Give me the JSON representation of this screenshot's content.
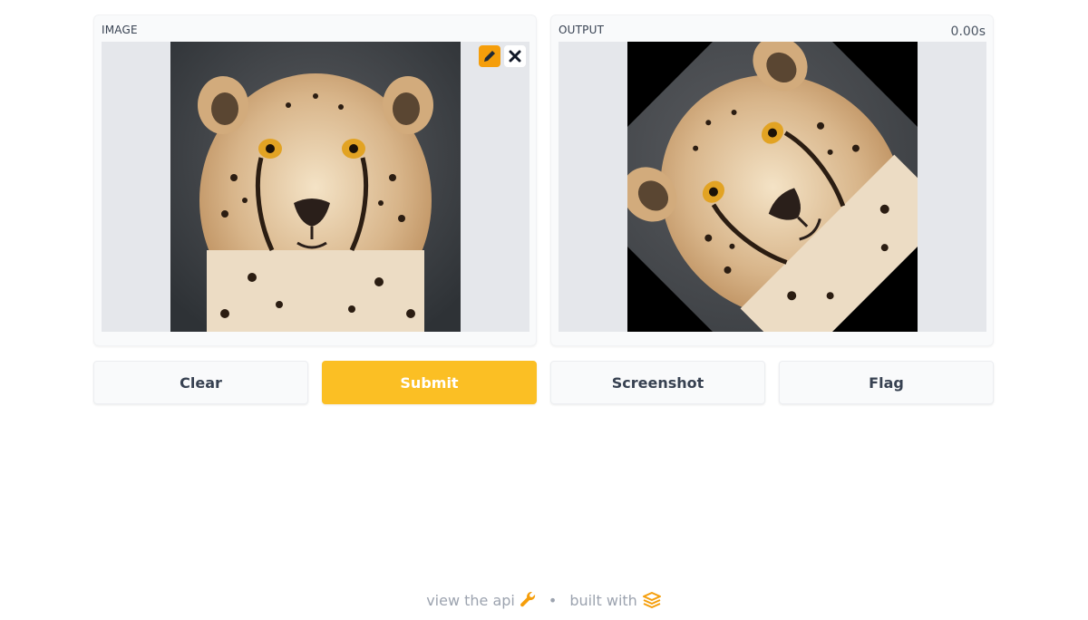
{
  "input_panel": {
    "label": "IMAGE",
    "image_alt": "cheetah portrait",
    "edit_icon": "pencil-icon",
    "clear_icon": "close-icon"
  },
  "output_panel": {
    "label": "OUTPUT",
    "timer": "0.00s",
    "image_alt": "cheetah portrait rotated 45 degrees"
  },
  "buttons": {
    "clear": "Clear",
    "submit": "Submit",
    "screenshot": "Screenshot",
    "flag": "Flag"
  },
  "footer": {
    "api_link": "view the api",
    "api_icon": "wrench-icon",
    "separator": "•",
    "built_with": "built with",
    "logo_icon": "gradio-logo-icon"
  },
  "colors": {
    "accent": "#fbbf24",
    "edit_button": "#f59e0b",
    "panel_bg": "#f9fafb",
    "frame_bg": "#e5e7eb"
  }
}
